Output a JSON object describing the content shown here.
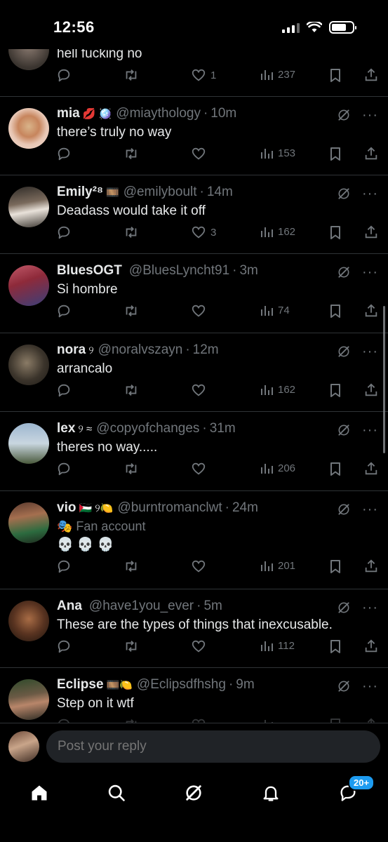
{
  "status_bar": {
    "time": "12:56"
  },
  "tweets": [
    {
      "name": "",
      "badges": "",
      "handle": "",
      "time": "",
      "text": "hell fucking no",
      "replies": "",
      "retweets": "",
      "likes": "1",
      "views": "237"
    },
    {
      "name": "mia",
      "badges": "💋 🪩",
      "handle": "@miaythology",
      "time": "10m",
      "text": "there’s truly no way",
      "replies": "",
      "retweets": "",
      "likes": "",
      "views": "153"
    },
    {
      "name": "Emily²⁸",
      "badges": "🎞️",
      "handle": "@emilyboult",
      "time": "14m",
      "text": "Deadass would take it off",
      "replies": "",
      "retweets": "",
      "likes": "3",
      "views": "162"
    },
    {
      "name": "BluesOGT",
      "badges": "",
      "handle": "@BluesLyncht91",
      "time": "3m",
      "text": "Si hombre",
      "replies": "",
      "retweets": "",
      "likes": "",
      "views": "74"
    },
    {
      "name": "nora",
      "badges": "୨",
      "handle": "@noralvszayn",
      "time": "12m",
      "text": "arrancalo",
      "replies": "",
      "retweets": "",
      "likes": "",
      "views": "162"
    },
    {
      "name": "lex",
      "badges": "୨ ≈",
      "handle": "@copyofchanges",
      "time": "31m",
      "text": "theres no way.....",
      "replies": "",
      "retweets": "",
      "likes": "",
      "views": "206"
    },
    {
      "name": "vio",
      "badges": "🇵🇸 ୨🍋",
      "handle": "@burntromanclwt",
      "time": "24m",
      "subtext": "🎭 Fan account",
      "text": "💀 💀 💀",
      "replies": "",
      "retweets": "",
      "likes": "",
      "views": "201"
    },
    {
      "name": "Ana",
      "badges": "",
      "handle": "@have1you_ever",
      "time": "5m",
      "text": "These are the types of things that inexcusable.",
      "replies": "",
      "retweets": "",
      "likes": "",
      "views": "112"
    },
    {
      "name": "Eclipse",
      "badges": "🎞️🍋",
      "handle": "@Eclipsdfhshg",
      "time": "9m",
      "text": "Step on it wtf",
      "replies": "",
      "retweets": "",
      "likes": "",
      "views": ""
    }
  ],
  "reply_bar": {
    "placeholder": "Post your reply"
  },
  "tabbar": {
    "items": [
      "home-icon",
      "search-icon",
      "grok-icon",
      "notifications-icon",
      "messages-icon"
    ],
    "messages_badge": "20+"
  },
  "colors": {
    "background": "#000000",
    "text": "#e7e9ea",
    "muted": "#71767b",
    "accent": "#1d9bf0",
    "divider": "#2f3336"
  }
}
